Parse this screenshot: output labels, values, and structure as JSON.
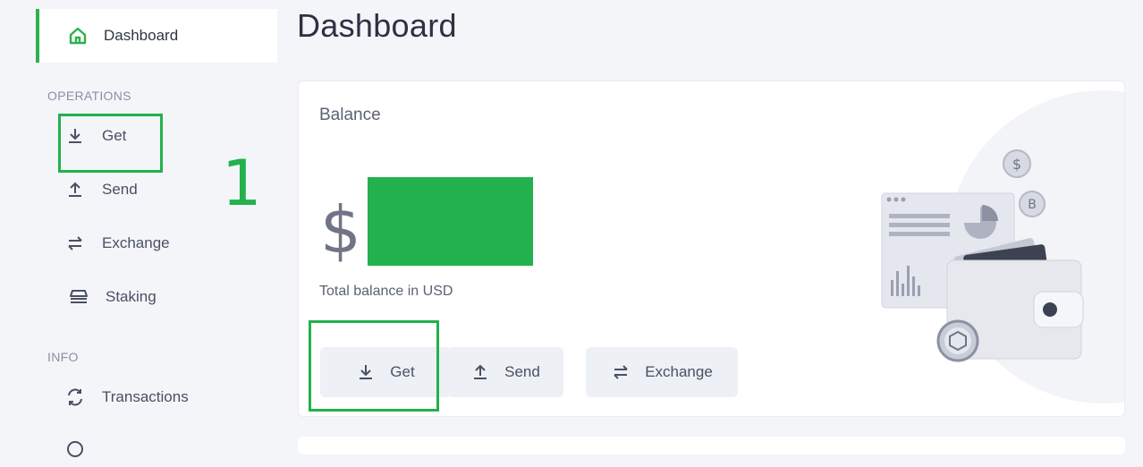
{
  "sidebar": {
    "active_item": {
      "label": "Dashboard",
      "icon": "home-icon"
    },
    "sections": [
      {
        "title": "OPERATIONS"
      },
      {
        "title": "INFO"
      }
    ],
    "operations": [
      {
        "label": "Get",
        "icon": "download-icon"
      },
      {
        "label": "Send",
        "icon": "upload-icon"
      },
      {
        "label": "Exchange",
        "icon": "exchange-icon"
      },
      {
        "label": "Staking",
        "icon": "staking-icon"
      }
    ],
    "info": [
      {
        "label": "Transactions",
        "icon": "transactions-icon"
      }
    ]
  },
  "annotation": {
    "step_number": "1",
    "color": "#22b14c"
  },
  "main": {
    "title": "Dashboard",
    "balance_card": {
      "title": "Balance",
      "currency_symbol": "$",
      "caption": "Total balance in USD",
      "actions": [
        {
          "label": "Get",
          "icon": "download-icon"
        },
        {
          "label": "Send",
          "icon": "upload-icon"
        },
        {
          "label": "Exchange",
          "icon": "exchange-icon"
        }
      ],
      "illustration": "wallet-illustration"
    }
  },
  "colors": {
    "accent": "#2db14c",
    "highlight": "#22b14c",
    "background": "#f3f5f9",
    "button_bg": "#edf0f5"
  }
}
